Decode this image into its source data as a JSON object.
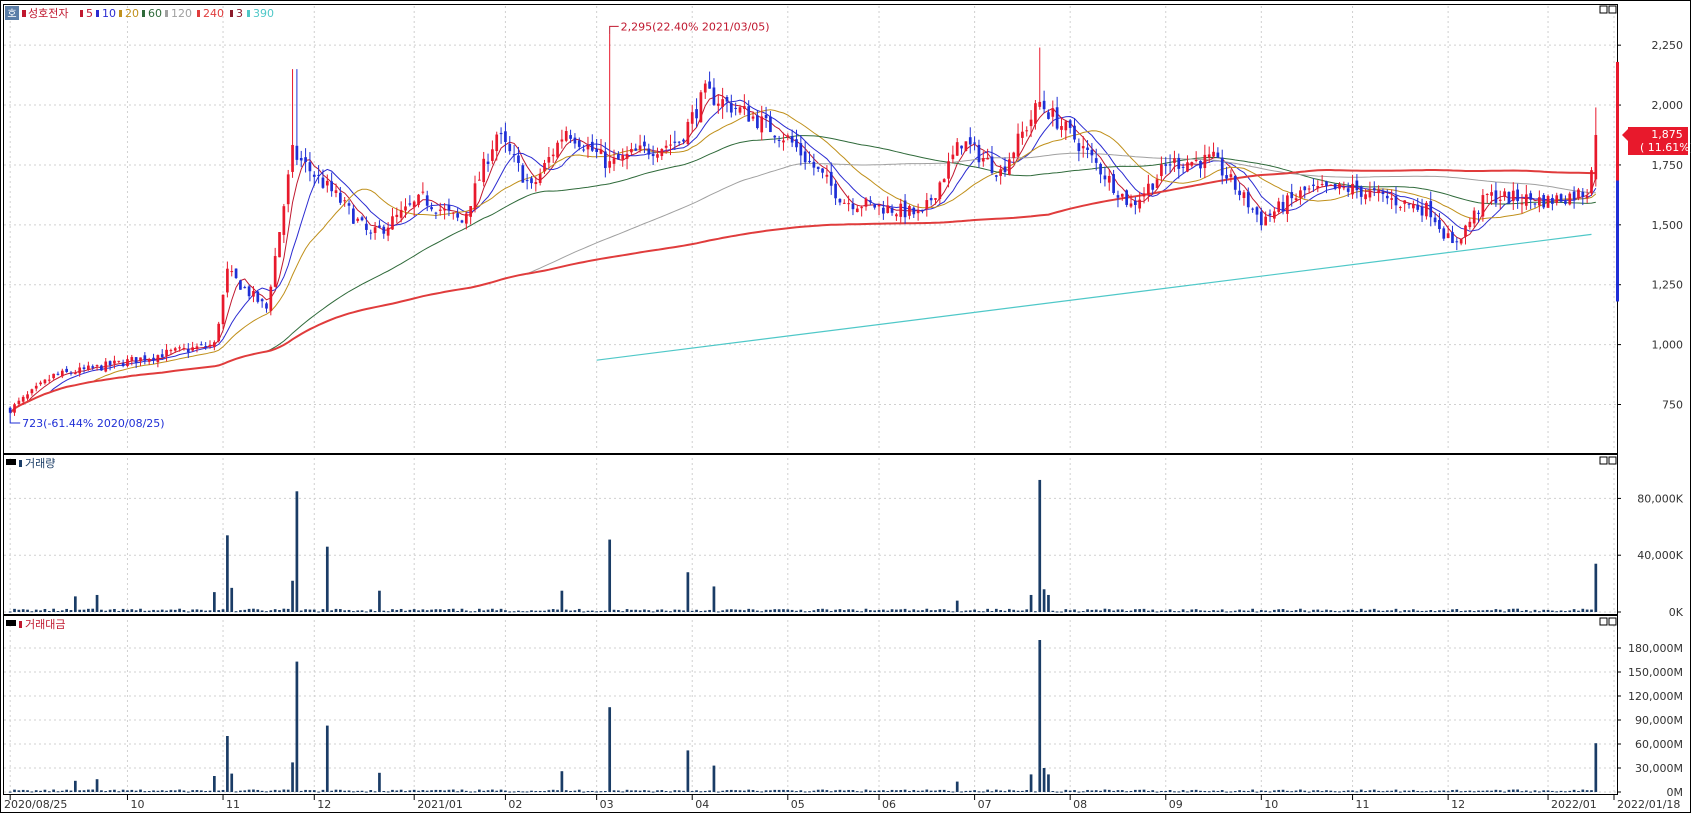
{
  "colors": {
    "up": "#e8192c",
    "down": "#1f2fd6",
    "ma5": "#c0182f",
    "ma10": "#2b2bd1",
    "ma20": "#c0901b",
    "ma60": "#2f6a3a",
    "ma120": "#a0a0a0",
    "ma240": "#e03c3c",
    "trend": "#4fc8c8",
    "volume": "#1a3c66",
    "grid": "#d0d0d0"
  },
  "icons": {
    "legend_square": "square-icon",
    "panel_control": "window-control-icon",
    "corner_badge": "corner-badge"
  },
  "legend": {
    "stock_name": "성호전자",
    "ma5_label": "5",
    "ma10_label": "10",
    "ma20_label": "20",
    "ma60_label": "60",
    "ma120_label": "120",
    "ma240_label": "240",
    "k3_label": "3",
    "k390_label": "390"
  },
  "corner_badge": "호",
  "volume_panel": {
    "label": "거래량"
  },
  "value_panel": {
    "label": "거래대금"
  },
  "chart_data": [
    {
      "type": "candlestick",
      "name": "성호전자",
      "ylim": [
        560,
        2330
      ],
      "yticks": [
        750,
        1000,
        1250,
        1500,
        1750,
        2000,
        2250
      ],
      "yticks_label": [
        "750",
        "1,000",
        "1,250",
        "1,500",
        "1,750",
        "2,000",
        "2,250"
      ],
      "price_min_marker": "723(-61.44% 2020/08/25)",
      "price_max_marker": "2,295(22.40% 2021/03/05)",
      "last_price_label": "1,875",
      "last_change_label": "( 11.61%)",
      "x_labels": [
        "2020/08/25",
        "10",
        "11",
        "12",
        "2021/01",
        "02",
        "03",
        "04",
        "05",
        "06",
        "07",
        "08",
        "09",
        "10",
        "11",
        "12",
        "2022/01",
        "2022/01/18"
      ],
      "x_label_dates": [
        "2020-08-25",
        "2020-10-01",
        "2020-11-01",
        "2020-12-01",
        "2021-01-01",
        "2021-02-01",
        "2021-03-02",
        "2021-04-01",
        "2021-05-03",
        "2021-06-01",
        "2021-07-01",
        "2021-08-02",
        "2021-09-01",
        "2021-10-01",
        "2021-11-01",
        "2021-12-01",
        "2022-01-03",
        "2022-01-18"
      ],
      "price_anchors": [
        [
          "2020-08-25",
          730
        ],
        [
          "2020-09-08",
          870
        ],
        [
          "2020-09-21",
          900
        ],
        [
          "2020-10-13",
          960
        ],
        [
          "2020-10-29",
          1000
        ],
        [
          "2020-11-03",
          1300
        ],
        [
          "2020-11-16",
          1150
        ],
        [
          "2020-11-24",
          1800
        ],
        [
          "2020-12-08",
          1620
        ],
        [
          "2020-12-18",
          1450
        ],
        [
          "2021-01-05",
          1610
        ],
        [
          "2021-01-18",
          1510
        ],
        [
          "2021-01-28",
          1880
        ],
        [
          "2021-02-09",
          1650
        ],
        [
          "2021-02-19",
          1900
        ],
        [
          "2021-03-05",
          1750
        ],
        [
          "2021-03-15",
          1800
        ],
        [
          "2021-03-29",
          1850
        ],
        [
          "2021-04-06",
          2050
        ],
        [
          "2021-04-20",
          1960
        ],
        [
          "2021-05-03",
          1860
        ],
        [
          "2021-05-20",
          1600
        ],
        [
          "2021-06-03",
          1570
        ],
        [
          "2021-06-15",
          1540
        ],
        [
          "2021-06-28",
          1850
        ],
        [
          "2021-07-09",
          1720
        ],
        [
          "2021-07-22",
          2010
        ],
        [
          "2021-08-03",
          1860
        ],
        [
          "2021-08-20",
          1580
        ],
        [
          "2021-09-02",
          1760
        ],
        [
          "2021-09-16",
          1770
        ],
        [
          "2021-10-01",
          1520
        ],
        [
          "2021-10-15",
          1640
        ],
        [
          "2021-11-01",
          1650
        ],
        [
          "2021-11-25",
          1560
        ],
        [
          "2021-12-02",
          1410
        ],
        [
          "2021-12-14",
          1620
        ],
        [
          "2022-01-03",
          1600
        ],
        [
          "2022-01-14",
          1640
        ],
        [
          "2022-01-18",
          1875
        ]
      ],
      "series": [
        {
          "name": "5",
          "source": "moving_average",
          "period": 5
        },
        {
          "name": "10",
          "source": "moving_average",
          "period": 10
        },
        {
          "name": "20",
          "source": "moving_average",
          "period": 20
        },
        {
          "name": "60",
          "source": "moving_average",
          "period": 60
        },
        {
          "name": "120",
          "source": "moving_average",
          "period": 120
        },
        {
          "name": "240",
          "source": "moving_average",
          "period": 240
        },
        {
          "name": "390",
          "source": "trend_line",
          "points": [
            [
              "2021-03-02",
              935
            ],
            [
              "2022-01-17",
              1460
            ]
          ]
        }
      ]
    },
    {
      "type": "bar",
      "name": "거래량",
      "ylim": [
        0,
        100000
      ],
      "yticks": [
        0,
        40000,
        80000
      ],
      "yticks_label": [
        "0K",
        "40,000K",
        "80,000K"
      ],
      "unit": "K",
      "base_value": 900,
      "spikes": [
        [
          "2020-09-15",
          11000
        ],
        [
          "2020-09-22",
          12000
        ],
        [
          "2020-10-29",
          14000
        ],
        [
          "2020-11-03",
          54000
        ],
        [
          "2020-11-04",
          17000
        ],
        [
          "2020-11-24",
          22000
        ],
        [
          "2020-11-25",
          85000
        ],
        [
          "2020-12-04",
          46000
        ],
        [
          "2020-12-22",
          15000
        ],
        [
          "2021-02-18",
          15000
        ],
        [
          "2021-03-05",
          51000
        ],
        [
          "2021-03-31",
          28000
        ],
        [
          "2021-04-08",
          18000
        ],
        [
          "2021-06-25",
          8000
        ],
        [
          "2021-07-20",
          12000
        ],
        [
          "2021-07-22",
          93000
        ],
        [
          "2021-07-23",
          16000
        ],
        [
          "2021-07-26",
          12000
        ],
        [
          "2022-01-18",
          34000
        ]
      ]
    },
    {
      "type": "bar",
      "name": "거래대금",
      "ylim": [
        0,
        200000
      ],
      "yticks": [
        0,
        30000,
        60000,
        90000,
        120000,
        150000,
        180000
      ],
      "yticks_label": [
        "0M",
        "30,000M",
        "60,000M",
        "90,000M",
        "120,000M",
        "150,000M",
        "180,000M"
      ],
      "unit": "M",
      "base_value": 1200,
      "spikes": [
        [
          "2020-09-15",
          14000
        ],
        [
          "2020-09-22",
          16000
        ],
        [
          "2020-10-29",
          20000
        ],
        [
          "2020-11-03",
          70000
        ],
        [
          "2020-11-04",
          23000
        ],
        [
          "2020-11-24",
          37000
        ],
        [
          "2020-11-25",
          163000
        ],
        [
          "2020-12-04",
          83000
        ],
        [
          "2020-12-22",
          24000
        ],
        [
          "2021-02-18",
          26000
        ],
        [
          "2021-03-05",
          106000
        ],
        [
          "2021-03-31",
          52000
        ],
        [
          "2021-04-08",
          33000
        ],
        [
          "2021-06-25",
          13000
        ],
        [
          "2021-07-20",
          22000
        ],
        [
          "2021-07-22",
          190000
        ],
        [
          "2021-07-23",
          30000
        ],
        [
          "2021-07-26",
          22000
        ],
        [
          "2022-01-18",
          61000
        ]
      ]
    }
  ]
}
